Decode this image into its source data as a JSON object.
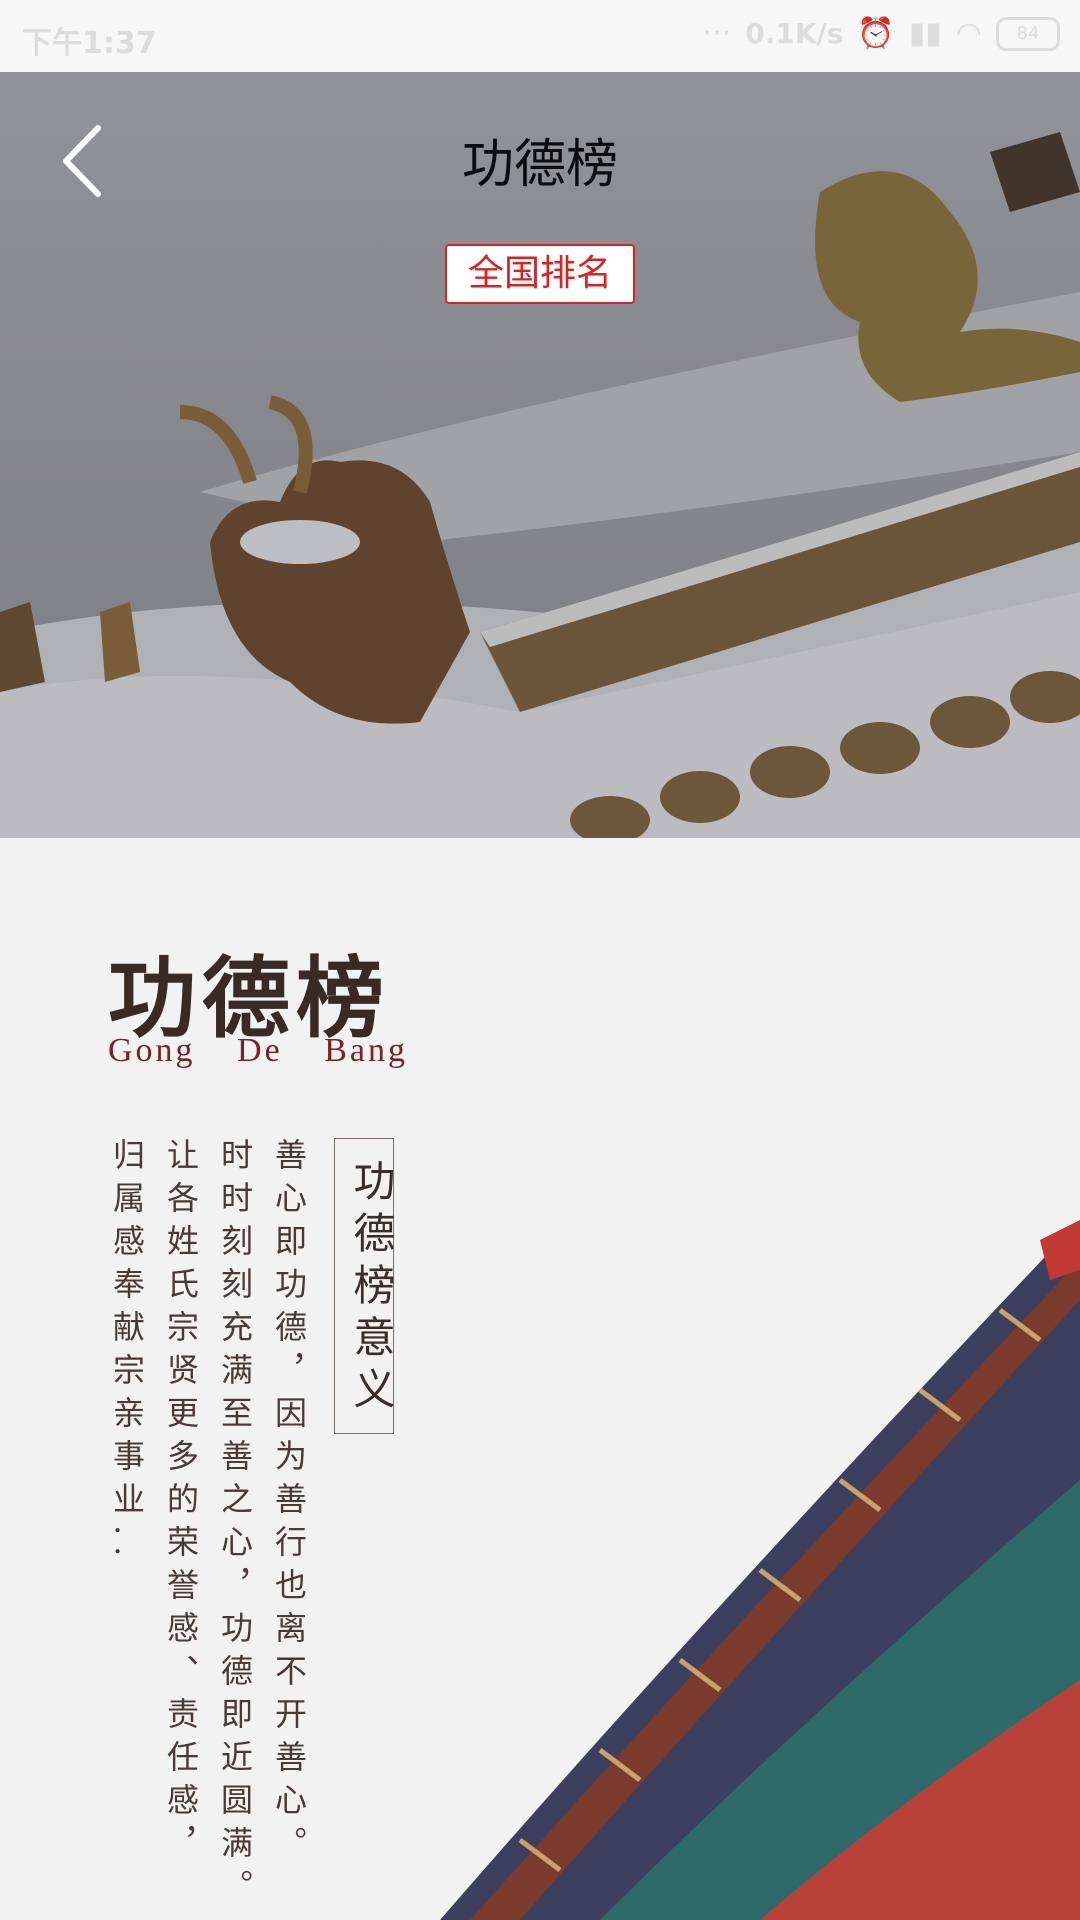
{
  "status_bar": {
    "time": "下午1:37",
    "network_speed": "0.1K/s",
    "battery": "84",
    "icons": [
      "alarm-icon",
      "signal-icon",
      "wifi-icon",
      "battery-icon"
    ]
  },
  "header": {
    "title": "功德榜",
    "back_icon": "chevron-left-icon",
    "rank_button_label": "全国排名"
  },
  "content": {
    "calligraphy_title": "功德榜",
    "pinyin": "Gong De Bang",
    "meaning_heading": "功德榜意义",
    "paragraph_columns": [
      "善心即功德，因为善行也离不开善心。",
      "时时刻刻充满至善之心，功德即近圆满。",
      "让各姓氏宗贤更多的荣誉感、责任感，",
      "归属感奉献宗亲事业.."
    ]
  },
  "colors": {
    "accent_red": "#e02020",
    "pinyin_red": "#7a2226",
    "background": "#f2f2f2"
  }
}
